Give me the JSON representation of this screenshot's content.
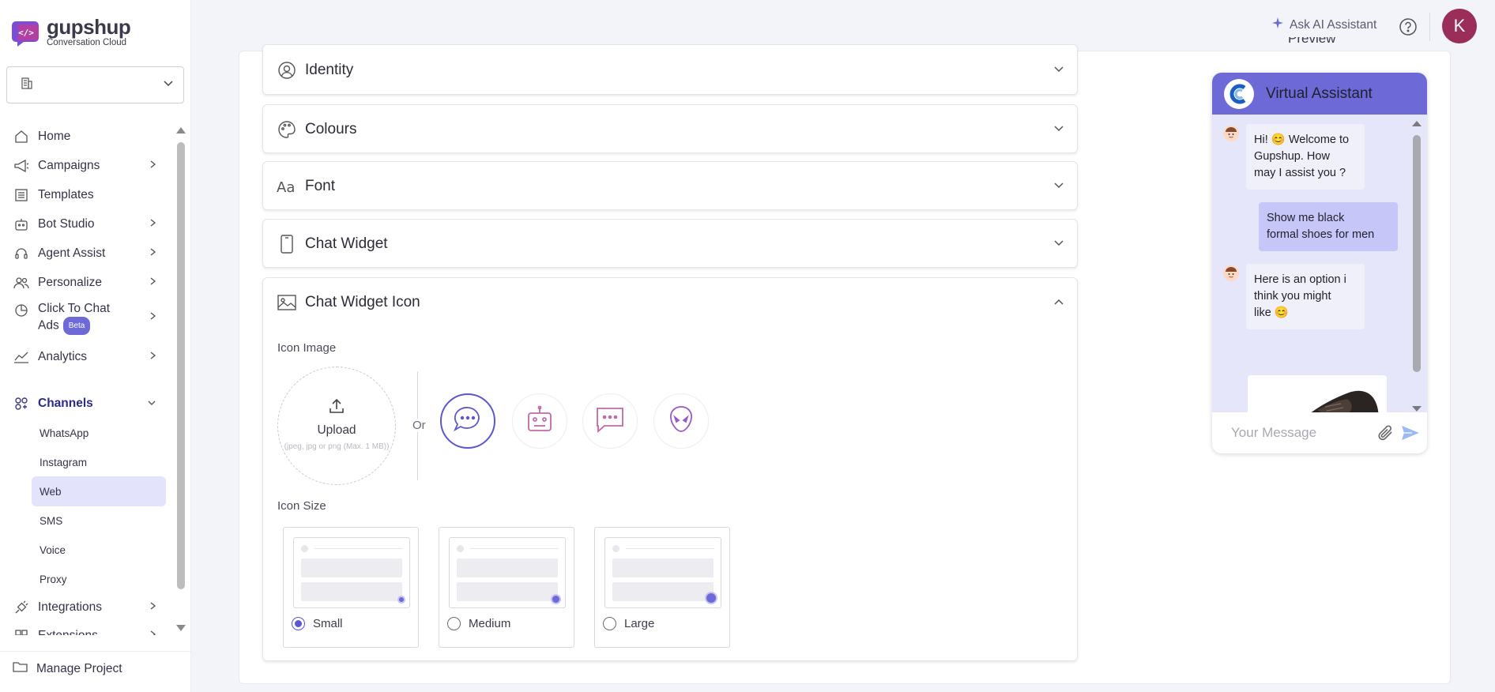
{
  "brand": {
    "name": "gupshup",
    "subtitle": "Conversation Cloud"
  },
  "project_select": {
    "value": ""
  },
  "nav": {
    "home": "Home",
    "campaigns": "Campaigns",
    "templates": "Templates",
    "bot_studio": "Bot Studio",
    "agent_assist": "Agent Assist",
    "personalize": "Personalize",
    "click_to_chat_line1": "Click To Chat",
    "click_to_chat_line2": "Ads",
    "beta": "Beta",
    "analytics": "Analytics",
    "channels": "Channels",
    "channel_items": [
      "WhatsApp",
      "Instagram",
      "Web",
      "SMS",
      "Voice",
      "Proxy"
    ],
    "integrations": "Integrations",
    "extensions": "Extensions",
    "manage_project": "Manage Project"
  },
  "topbar": {
    "ask_ai": "Ask AI Assistant",
    "avatar_initial": "K"
  },
  "sections": {
    "identity": "Identity",
    "colours": "Colours",
    "font": "Font",
    "chat_widget": "Chat Widget",
    "chat_widget_icon": "Chat Widget Icon"
  },
  "icon_image": {
    "label": "Icon Image",
    "upload_label": "Upload",
    "upload_hint": "(jpeg, jpg or png (Max. 1 MB))",
    "or": "Or",
    "selected_index": 0
  },
  "icon_size": {
    "label": "Icon Size",
    "options": [
      "Small",
      "Medium",
      "Large"
    ],
    "selected": "Small"
  },
  "preview": {
    "label": "Preview",
    "title": "Virtual Assistant",
    "messages": {
      "bot1_line1": "Hi! 😊 Welcome to",
      "bot1_line2": "Gupshup. How",
      "bot1_line3": "may I assist you ?",
      "user1_line1": "Show me black",
      "user1_line2": "formal shoes for men",
      "bot2_line1": "Here is an option i",
      "bot2_line2": "think you might",
      "bot2_line3": "like 😊"
    },
    "input_placeholder": "Your Message"
  },
  "colors": {
    "accent": "#5b57d1",
    "header": "#6d6ad8",
    "chat_bg": "#e6e6fb",
    "user_bubble": "#c7c6f8"
  }
}
